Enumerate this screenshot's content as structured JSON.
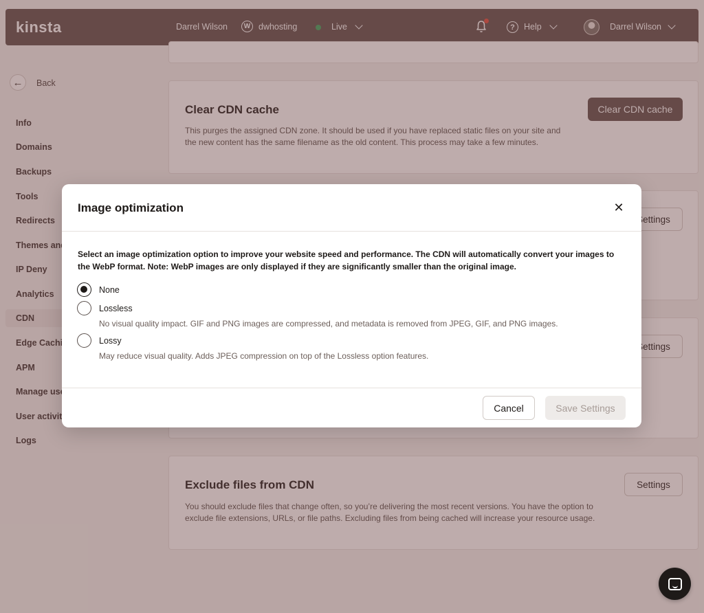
{
  "topbar": {
    "logo": "kinsta",
    "user_name": "Darrel Wilson",
    "site_name": "dwhosting",
    "environment": "Live",
    "help_label": "Help",
    "account_name": "Darrel Wilson",
    "status_color": "#3da35d",
    "notification_color": "#e04a3a"
  },
  "sidebar": {
    "back_label": "Back",
    "items": [
      {
        "label": "Info"
      },
      {
        "label": "Domains"
      },
      {
        "label": "Backups"
      },
      {
        "label": "Tools"
      },
      {
        "label": "Redirects"
      },
      {
        "label": "Themes and"
      },
      {
        "label": "IP Deny"
      },
      {
        "label": "Analytics"
      },
      {
        "label": "CDN",
        "active": true
      },
      {
        "label": "Edge Cachin"
      },
      {
        "label": "APM"
      },
      {
        "label": "Manage use"
      },
      {
        "label": "User activity"
      },
      {
        "label": "Logs"
      }
    ]
  },
  "main": {
    "clear_cdn": {
      "title": "Clear CDN cache",
      "description": "This purges the assigned CDN zone. It should be used if you have replaced static files on your site and the new content has the same filename as the old content. This process may take a few minutes.",
      "button": "Clear CDN cache"
    },
    "settings_button_1": "Settings",
    "settings_button_2": "Settings",
    "exclude_files": {
      "title": "Exclude files from CDN",
      "description": "You should exclude files that change often, so you’re delivering the most recent versions. You have the option to exclude file extensions, URLs, or file paths. Excluding files from being cached will increase your resource usage.",
      "button": "Settings"
    }
  },
  "modal": {
    "title": "Image optimization",
    "intro": "Select an image optimization option to improve your website speed and performance. The CDN will automatically convert your images to the WebP format. Note: WebP images are only displayed if they are significantly smaller than the original image.",
    "options": [
      {
        "label": "None",
        "description": "",
        "selected": true
      },
      {
        "label": "Lossless",
        "description": "No visual quality impact. GIF and PNG images are compressed, and metadata is removed from JPEG, GIF, and PNG images.",
        "selected": false
      },
      {
        "label": "Lossy",
        "description": "May reduce visual quality. Adds JPEG compression on top of the Lossless option features.",
        "selected": false
      }
    ],
    "cancel_label": "Cancel",
    "save_label": "Save Settings"
  },
  "icons": {
    "close": "close-icon",
    "back": "arrow-left-icon",
    "bell": "bell-icon",
    "help": "help-circle-icon",
    "wordpress": "wordpress-icon",
    "chat": "chat-icon"
  },
  "colors": {
    "brand_dark": "#5f4e4a",
    "overlay": "rgba(110,72,70,0.45)"
  }
}
